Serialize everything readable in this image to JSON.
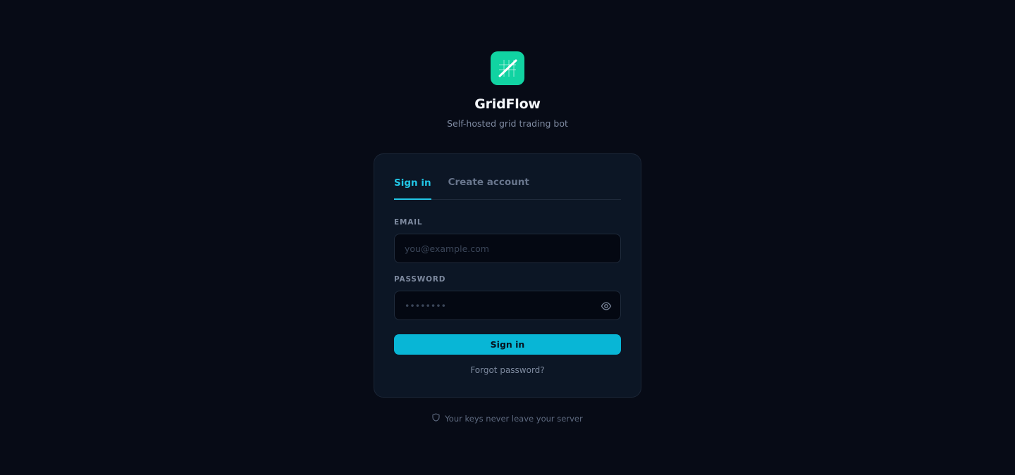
{
  "brand": {
    "logo_icon": "grid-chart-icon",
    "name": "GridFlow",
    "tagline": "Self-hosted grid trading bot",
    "accent": "#11d3a2"
  },
  "auth": {
    "tabs": [
      {
        "label": "Sign in",
        "active": true
      },
      {
        "label": "Create account",
        "active": false
      }
    ],
    "email": {
      "label": "EMAIL",
      "value": "",
      "placeholder": "you@example.com"
    },
    "password": {
      "label": "PASSWORD",
      "value": "",
      "placeholder": "••••••••",
      "toggle_icon": "eye-icon"
    },
    "submit_label": "Sign in",
    "forgot_label": "Forgot password?",
    "accent": "#08b6d6"
  },
  "footer": {
    "icon": "shield-icon",
    "text": "Your keys never leave your server"
  }
}
